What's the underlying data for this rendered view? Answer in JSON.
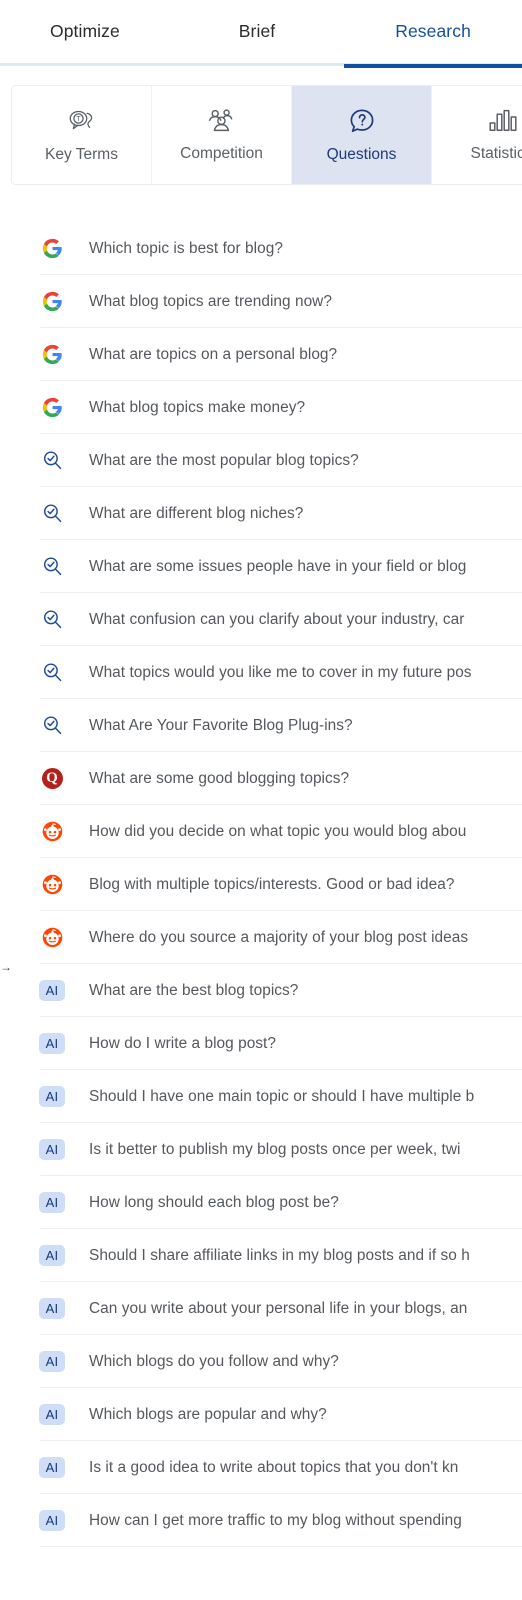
{
  "top_tabs": [
    {
      "label": "Optimize",
      "active": false
    },
    {
      "label": "Brief",
      "active": false
    },
    {
      "label": "Research",
      "active": true
    }
  ],
  "sub_tabs": [
    {
      "label": "Key Terms",
      "icon": "speech-bubble-t-icon",
      "active": false
    },
    {
      "label": "Competition",
      "icon": "people-group-icon",
      "active": false
    },
    {
      "label": "Questions",
      "icon": "question-bubble-icon",
      "active": true
    },
    {
      "label": "Statistics",
      "icon": "bar-chart-icon",
      "active": false
    }
  ],
  "colors": {
    "accent_blue": "#0e4ea6",
    "active_tab_text": "#12509f",
    "active_subtab_bg": "#dde3f1",
    "active_subtab_text": "#1e3a78",
    "row_text": "#54585d",
    "divider": "#eceef0",
    "quora_red": "#b3211d",
    "reddit_orange": "#ff4500",
    "ai_badge_bg": "#cfdef7",
    "ai_badge_text": "#15387c"
  },
  "edge_marker": "→",
  "questions": [
    {
      "source": "google",
      "source_label": "G",
      "text": "Which topic is best for blog?"
    },
    {
      "source": "google",
      "source_label": "G",
      "text": "What blog topics are trending now?"
    },
    {
      "source": "google",
      "source_label": "G",
      "text": "What are topics on a personal blog?"
    },
    {
      "source": "google",
      "source_label": "G",
      "text": "What blog topics make money?"
    },
    {
      "source": "bing",
      "source_label": "",
      "text": "What are the most popular blog topics?"
    },
    {
      "source": "bing",
      "source_label": "",
      "text": "What are different blog niches?"
    },
    {
      "source": "bing",
      "source_label": "",
      "text": "What are some issues people have in your field or blog"
    },
    {
      "source": "bing",
      "source_label": "",
      "text": "What confusion can you clarify about your industry, car"
    },
    {
      "source": "bing",
      "source_label": "",
      "text": "What topics would you like me to cover in my future pos"
    },
    {
      "source": "bing",
      "source_label": "",
      "text": "What Are Your Favorite Blog Plug-ins?"
    },
    {
      "source": "quora",
      "source_label": "Q",
      "text": "What are some good blogging topics?"
    },
    {
      "source": "reddit",
      "source_label": "",
      "text": "How did you decide on what topic you would blog abou"
    },
    {
      "source": "reddit",
      "source_label": "",
      "text": "Blog with multiple topics/interests. Good or bad idea?"
    },
    {
      "source": "reddit",
      "source_label": "",
      "text": "Where do you source a majority of your blog post ideas"
    },
    {
      "source": "ai",
      "source_label": "AI",
      "text": "What are the best blog topics?"
    },
    {
      "source": "ai",
      "source_label": "AI",
      "text": "How do I write a blog post?"
    },
    {
      "source": "ai",
      "source_label": "AI",
      "text": "Should I have one main topic or should I have multiple b"
    },
    {
      "source": "ai",
      "source_label": "AI",
      "text": "Is it better to publish my blog posts once per week, twi"
    },
    {
      "source": "ai",
      "source_label": "AI",
      "text": "How long should each blog post be?"
    },
    {
      "source": "ai",
      "source_label": "AI",
      "text": "Should I share affiliate links in my blog posts and if so h"
    },
    {
      "source": "ai",
      "source_label": "AI",
      "text": "Can you write about your personal life in your blogs, an"
    },
    {
      "source": "ai",
      "source_label": "AI",
      "text": "Which blogs do you follow and why?"
    },
    {
      "source": "ai",
      "source_label": "AI",
      "text": "Which blogs are popular and why?"
    },
    {
      "source": "ai",
      "source_label": "AI",
      "text": "Is it a good idea to write about topics that you don't kn"
    },
    {
      "source": "ai",
      "source_label": "AI",
      "text": "How can I get more traffic to my blog without spending"
    }
  ]
}
